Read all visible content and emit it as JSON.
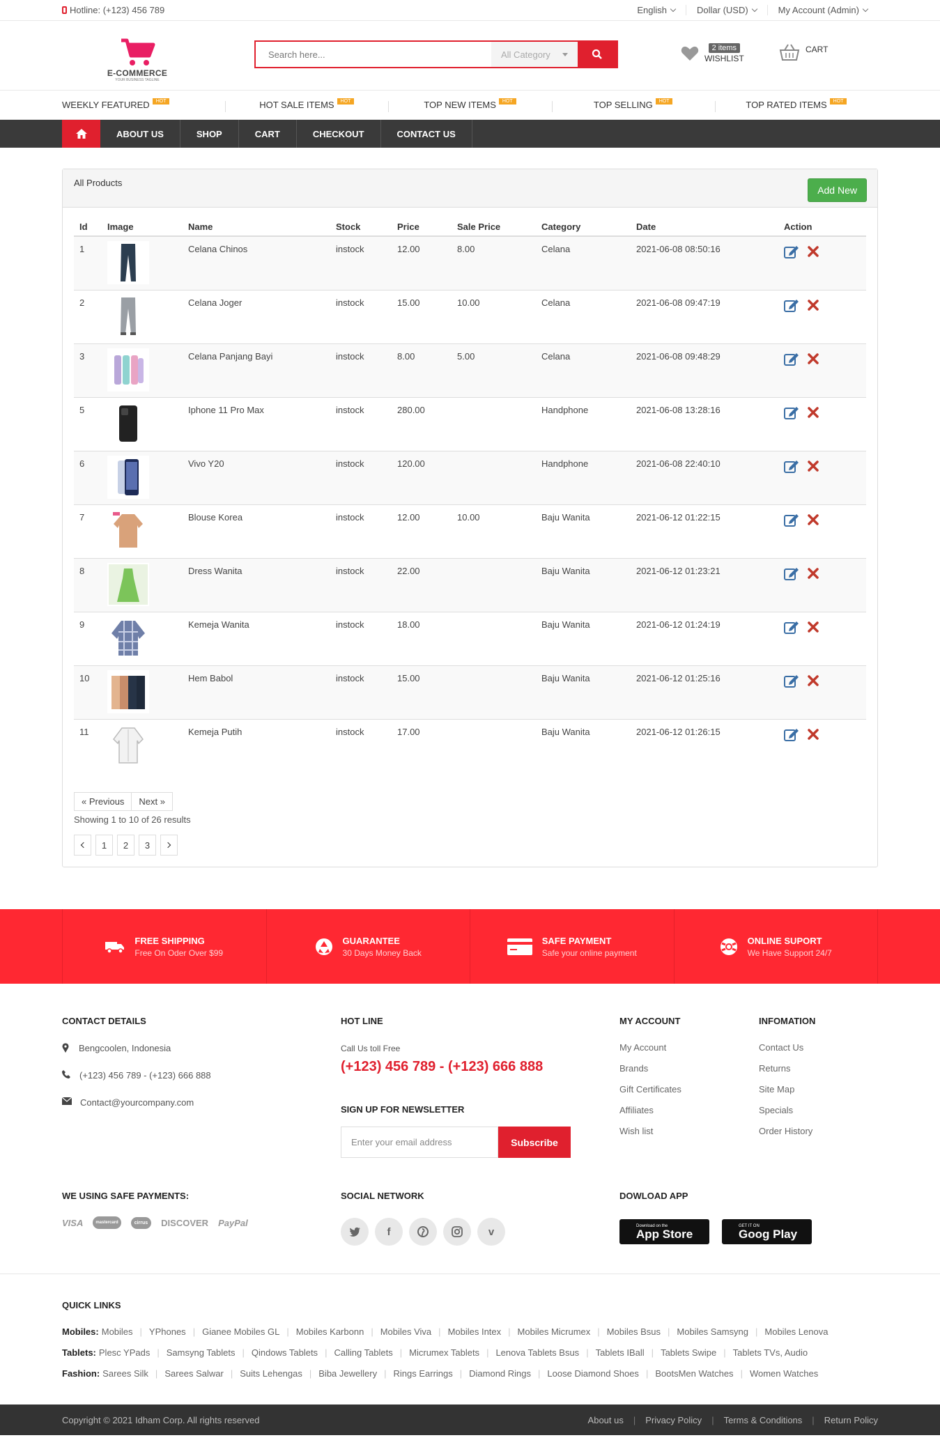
{
  "topbar": {
    "hotline": "Hotline: (+123) 456 789",
    "language": "English",
    "currency": "Dollar (USD)",
    "account": "My Account (Admin)"
  },
  "header": {
    "logo_title": "E-COMMERCE",
    "logo_sub": "YOUR BUSINESS TAGLINE",
    "search_placeholder": "Search here...",
    "category": "All Category",
    "wishlist_count": "2 items",
    "wishlist_label": "WISHLIST",
    "cart_label": "CART"
  },
  "strip": [
    {
      "label": "WEEKLY FEATURED",
      "badge": "HOT"
    },
    {
      "label": "HOT SALE ITEMS",
      "badge": "HOT"
    },
    {
      "label": "TOP NEW ITEMS",
      "badge": "HOT"
    },
    {
      "label": "TOP SELLING",
      "badge": "HOT"
    },
    {
      "label": "TOP RATED ITEMS",
      "badge": "HOT"
    }
  ],
  "nav": [
    "ABOUT US",
    "SHOP",
    "CART",
    "CHECKOUT",
    "CONTACT US"
  ],
  "panel": {
    "title": "All Products",
    "add_button": "Add New",
    "columns": [
      "Id",
      "Image",
      "Name",
      "Stock",
      "Price",
      "Sale Price",
      "Category",
      "Date",
      "Action"
    ],
    "rows": [
      {
        "id": "1",
        "img": "pants-dark",
        "name": "Celana Chinos",
        "stock": "instock",
        "price": "12.00",
        "sale": "8.00",
        "category": "Celana",
        "date": "2021-06-08 08:50:16"
      },
      {
        "id": "2",
        "img": "pants-grey",
        "name": "Celana Joger",
        "stock": "instock",
        "price": "15.00",
        "sale": "10.00",
        "category": "Celana",
        "date": "2021-06-08 09:47:19"
      },
      {
        "id": "3",
        "img": "baby-pants",
        "name": "Celana Panjang Bayi",
        "stock": "instock",
        "price": "8.00",
        "sale": "5.00",
        "category": "Celana",
        "date": "2021-06-08 09:48:29"
      },
      {
        "id": "5",
        "img": "phone-dark",
        "name": "Iphone 11 Pro Max",
        "stock": "instock",
        "price": "280.00",
        "sale": "",
        "category": "Handphone",
        "date": "2021-06-08 13:28:16"
      },
      {
        "id": "6",
        "img": "phone-blue",
        "name": "Vivo Y20",
        "stock": "instock",
        "price": "120.00",
        "sale": "",
        "category": "Handphone",
        "date": "2021-06-08 22:40:10"
      },
      {
        "id": "7",
        "img": "blouse",
        "name": "Blouse Korea",
        "stock": "instock",
        "price": "12.00",
        "sale": "10.00",
        "category": "Baju Wanita",
        "date": "2021-06-12 01:22:15"
      },
      {
        "id": "8",
        "img": "dress-green",
        "name": "Dress Wanita",
        "stock": "instock",
        "price": "22.00",
        "sale": "",
        "category": "Baju Wanita",
        "date": "2021-06-12 01:23:21"
      },
      {
        "id": "9",
        "img": "shirt-plaid",
        "name": "Kemeja Wanita",
        "stock": "instock",
        "price": "18.00",
        "sale": "",
        "category": "Baju Wanita",
        "date": "2021-06-12 01:24:19"
      },
      {
        "id": "10",
        "img": "coats",
        "name": "Hem Babol",
        "stock": "instock",
        "price": "15.00",
        "sale": "",
        "category": "Baju Wanita",
        "date": "2021-06-12 01:25:16"
      },
      {
        "id": "11",
        "img": "shirt-white",
        "name": "Kemeja Putih",
        "stock": "instock",
        "price": "17.00",
        "sale": "",
        "category": "Baju Wanita",
        "date": "2021-06-12 01:26:15"
      }
    ],
    "prev": "« Previous",
    "next": "Next »",
    "showing": "Showing 1 to 10 of 26 results",
    "pages": [
      "1",
      "2",
      "3"
    ]
  },
  "services": [
    {
      "title": "FREE SHIPPING",
      "sub": "Free On Oder Over $99",
      "icon": "truck-icon"
    },
    {
      "title": "GUARANTEE",
      "sub": "30 Days Money Back",
      "icon": "recycle-icon"
    },
    {
      "title": "SAFE PAYMENT",
      "sub": "Safe your online payment",
      "icon": "credit-card-icon"
    },
    {
      "title": "ONLINE SUPORT",
      "sub": "We Have Support 24/7",
      "icon": "life-ring-icon"
    }
  ],
  "footer": {
    "contact_title": "CONTACT DETAILS",
    "address": "Bengcoolen, Indonesia",
    "phones": "(+123) 456 789 - (+123) 666 888",
    "email": "Contact@yourcompany.com",
    "hotline_title": "HOT LINE",
    "hotline_sub": "Call Us toll Free",
    "hotline_num": "(+123) 456 789 - (+123) 666 888",
    "newsletter_title": "SIGN UP FOR NEWSLETTER",
    "newsletter_placeholder": "Enter your email address",
    "subscribe": "Subscribe",
    "account_title": "MY ACCOUNT",
    "account_links": [
      "My Account",
      "Brands",
      "Gift Certificates",
      "Affiliates",
      "Wish list"
    ],
    "info_title": "INFOMATION",
    "info_links": [
      "Contact Us",
      "Returns",
      "Site Map",
      "Specials",
      "Order History"
    ],
    "payments_title": "WE USING SAFE PAYMENTS:",
    "payments": [
      "VISA",
      "mastercard",
      "cirrus",
      "DISCOVER",
      "PayPal"
    ],
    "social_title": "SOCIAL NETWORK",
    "app_title": "DOWLOAD APP",
    "app_store_small": "Download on the",
    "app_store": "App Store",
    "google_small": "GET IT ON",
    "google": "Goog Play"
  },
  "quick_links": {
    "title": "QUICK LINKS",
    "rows": [
      {
        "key": "Mobiles:",
        "items": [
          "Mobiles",
          "YPhones",
          "Gianee Mobiles GL",
          "Mobiles Karbonn",
          "Mobiles Viva",
          "Mobiles Intex",
          "Mobiles Micrumex",
          "Mobiles Bsus",
          "Mobiles Samsyng",
          "Mobiles Lenova"
        ]
      },
      {
        "key": "Tablets:",
        "items": [
          "Plesc YPads",
          "Samsyng Tablets",
          "Qindows Tablets",
          "Calling Tablets",
          "Micrumex Tablets",
          "Lenova Tablets Bsus",
          "Tablets IBall",
          "Tablets Swipe",
          "Tablets TVs, Audio"
        ]
      },
      {
        "key": "Fashion:",
        "items": [
          "Sarees Silk",
          "Sarees Salwar",
          "Suits Lehengas",
          "Biba Jewellery",
          "Rings Earrings",
          "Diamond Rings",
          "Loose Diamond Shoes",
          "BootsMen Watches",
          "Women Watches"
        ]
      }
    ]
  },
  "copyright": {
    "text": "Copyright © 2021 Idham Corp. All rights reserved",
    "links": [
      "About us",
      "Privacy Policy",
      "Terms & Conditions",
      "Return Policy"
    ]
  },
  "colors": {
    "accent": "#e0202e",
    "services_bg": "#ff2832",
    "nav_bg": "#3a3a3a",
    "add_btn": "#4cae4c"
  }
}
